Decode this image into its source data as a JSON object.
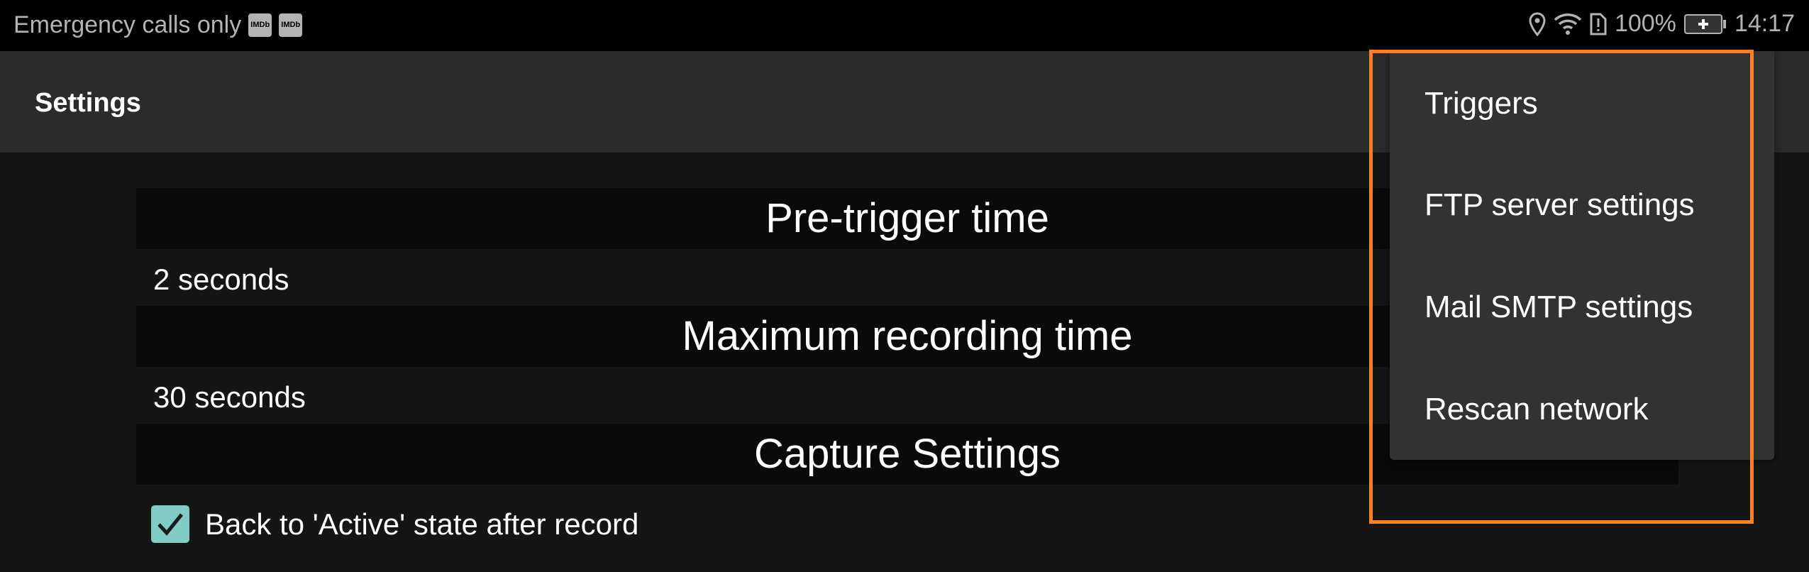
{
  "status_bar": {
    "carrier_text": "Emergency calls only",
    "notification_icons": [
      "IMDb",
      "IMDb"
    ],
    "icons": [
      "location-icon",
      "wifi-icon",
      "sim-alert-icon",
      "battery-charging-icon"
    ],
    "battery_percent": "100%",
    "time": "14:17"
  },
  "app_bar": {
    "title": "Settings"
  },
  "settings": {
    "sections": [
      {
        "header": "Pre-trigger time",
        "value": "2 seconds"
      },
      {
        "header": "Maximum recording time",
        "value": "30 seconds"
      },
      {
        "header": "Capture Settings"
      }
    ],
    "checkbox": {
      "label": "Back to 'Active' state after record",
      "checked": true
    }
  },
  "overflow_menu": {
    "items": [
      {
        "label": "Triggers"
      },
      {
        "label": "FTP server settings"
      },
      {
        "label": "Mail SMTP settings"
      },
      {
        "label": "Rescan network"
      }
    ]
  },
  "colors": {
    "accent": "#80cbc4",
    "highlight": "#ff7f27",
    "menu_bg": "#323232",
    "app_bar": "#2b2b2b"
  }
}
